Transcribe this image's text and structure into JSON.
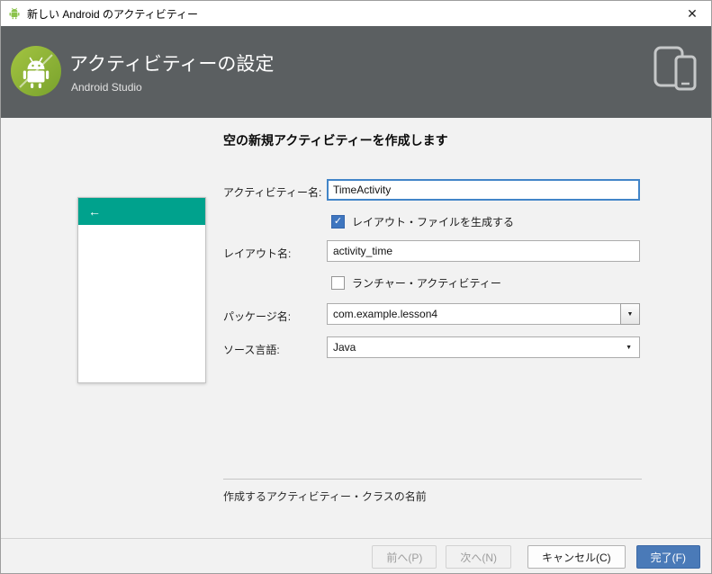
{
  "window": {
    "title": "新しい Android のアクティビティー"
  },
  "icons": {
    "close": "✕",
    "back_arrow": "←",
    "dropdown_arrow": "▼",
    "check": "✓"
  },
  "header": {
    "title": "アクティビティーの設定",
    "subtitle": "Android Studio"
  },
  "main": {
    "heading": "空の新規アクティビティーを作成します",
    "activity_name": {
      "label": "アクティビティー名:",
      "value": "TimeActivity"
    },
    "generate_layout": {
      "label": "レイアウト・ファイルを生成する",
      "checked": true
    },
    "layout_name": {
      "label": "レイアウト名:",
      "value": "activity_time"
    },
    "launcher_activity": {
      "label": "ランチャー・アクティビティー",
      "checked": false
    },
    "package_name": {
      "label": "パッケージ名:",
      "value": "com.example.lesson4"
    },
    "source_language": {
      "label": "ソース言語:",
      "value": "Java"
    },
    "help_text": "作成するアクティビティー・クラスの名前"
  },
  "footer": {
    "previous_label": "前へ(P)",
    "next_label": "次へ(N)",
    "cancel_label": "キャンセル(C)",
    "finish_label": "完了(F)"
  },
  "colors": {
    "header_bg": "#5b5f61",
    "accent_teal": "#00a28d",
    "primary_button": "#4a7ab8",
    "focus_border": "#4285c8"
  }
}
